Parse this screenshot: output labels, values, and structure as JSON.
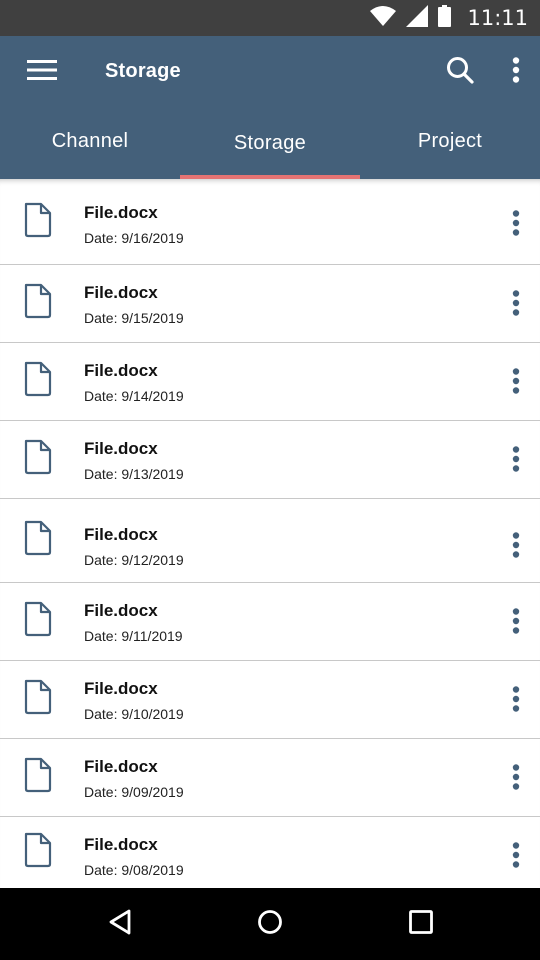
{
  "status_bar": {
    "time": "11:11",
    "icons": [
      "wifi-icon",
      "cell-signal-icon",
      "battery-icon"
    ]
  },
  "app_bar": {
    "title": "Storage",
    "icons": [
      "menu-icon",
      "search-icon",
      "more-vert-icon"
    ],
    "color": "#44607a"
  },
  "tabs": [
    {
      "label": "Channel",
      "active": false
    },
    {
      "label": "Storage",
      "active": true
    },
    {
      "label": "Project",
      "active": false
    }
  ],
  "accent_color": "#e57373",
  "files": [
    {
      "name": "File.docx",
      "date": "Date: 9/16/2019"
    },
    {
      "name": "File.docx",
      "date": "Date: 9/15/2019"
    },
    {
      "name": "File.docx",
      "date": "Date: 9/14/2019"
    },
    {
      "name": "File.docx",
      "date": "Date: 9/13/2019"
    },
    {
      "name": "File.docx",
      "date": "Date: 9/12/2019"
    },
    {
      "name": "File.docx",
      "date": "Date: 9/11/2019"
    },
    {
      "name": "File.docx",
      "date": "Date: 9/10/2019"
    },
    {
      "name": "File.docx",
      "date": "Date: 9/09/2019"
    },
    {
      "name": "File.docx",
      "date": "Date: 9/08/2019"
    }
  ],
  "nav_bar": {
    "icons": [
      "back-icon",
      "home-icon",
      "recents-icon"
    ]
  }
}
